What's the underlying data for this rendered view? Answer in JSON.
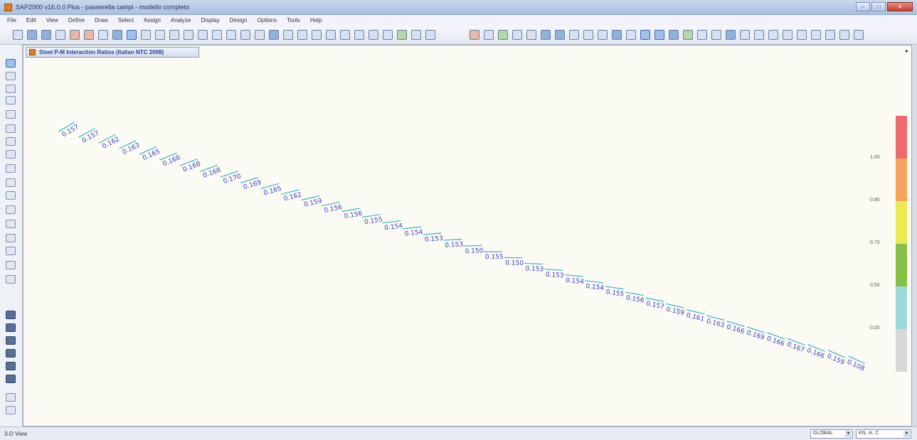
{
  "window": {
    "title": "SAP2000 v16.0.0 Plus - passerella campi - modello completo",
    "controls": {
      "minimize": "–",
      "maximize": "□",
      "close": "✕"
    }
  },
  "menu": [
    "File",
    "Edit",
    "View",
    "Define",
    "Draw",
    "Select",
    "Assign",
    "Analyze",
    "Display",
    "Design",
    "Options",
    "Tools",
    "Help"
  ],
  "document": {
    "tab_title": "Steel P-M Interaction Ratios (Italian NTC 2008)",
    "scroll_arrow": "▸"
  },
  "ratios": [
    "0.157",
    "0.157",
    "0.162",
    "0.163",
    "0.165",
    "0.168",
    "0.168",
    "0.168",
    "0.170",
    "0.169",
    "0.165",
    "0.162",
    "0.159",
    "0.156",
    "0.156",
    "0.155",
    "0.154",
    "0.154",
    "0.153",
    "0.153",
    "0.150",
    "0.155",
    "0.150",
    "0.153",
    "0.153",
    "0.154",
    "0.154",
    "0.155",
    "0.156",
    "0.157",
    "0.159",
    "0.161",
    "0.163",
    "0.166",
    "0.169",
    "0.166",
    "0.167",
    "0.166",
    "0.159",
    "0.108"
  ],
  "legend": {
    "labels": [
      "1.00",
      "0.90",
      "0.70",
      "0.50",
      "0.00"
    ],
    "colors": [
      "#ee6a6e",
      "#f5a45d",
      "#eaea55",
      "#86c044",
      "#9bd9db",
      "#d8d8d8"
    ]
  },
  "status": {
    "view": "3-D View",
    "coord_system": "GLOBAL",
    "units": "KN, m, C"
  }
}
